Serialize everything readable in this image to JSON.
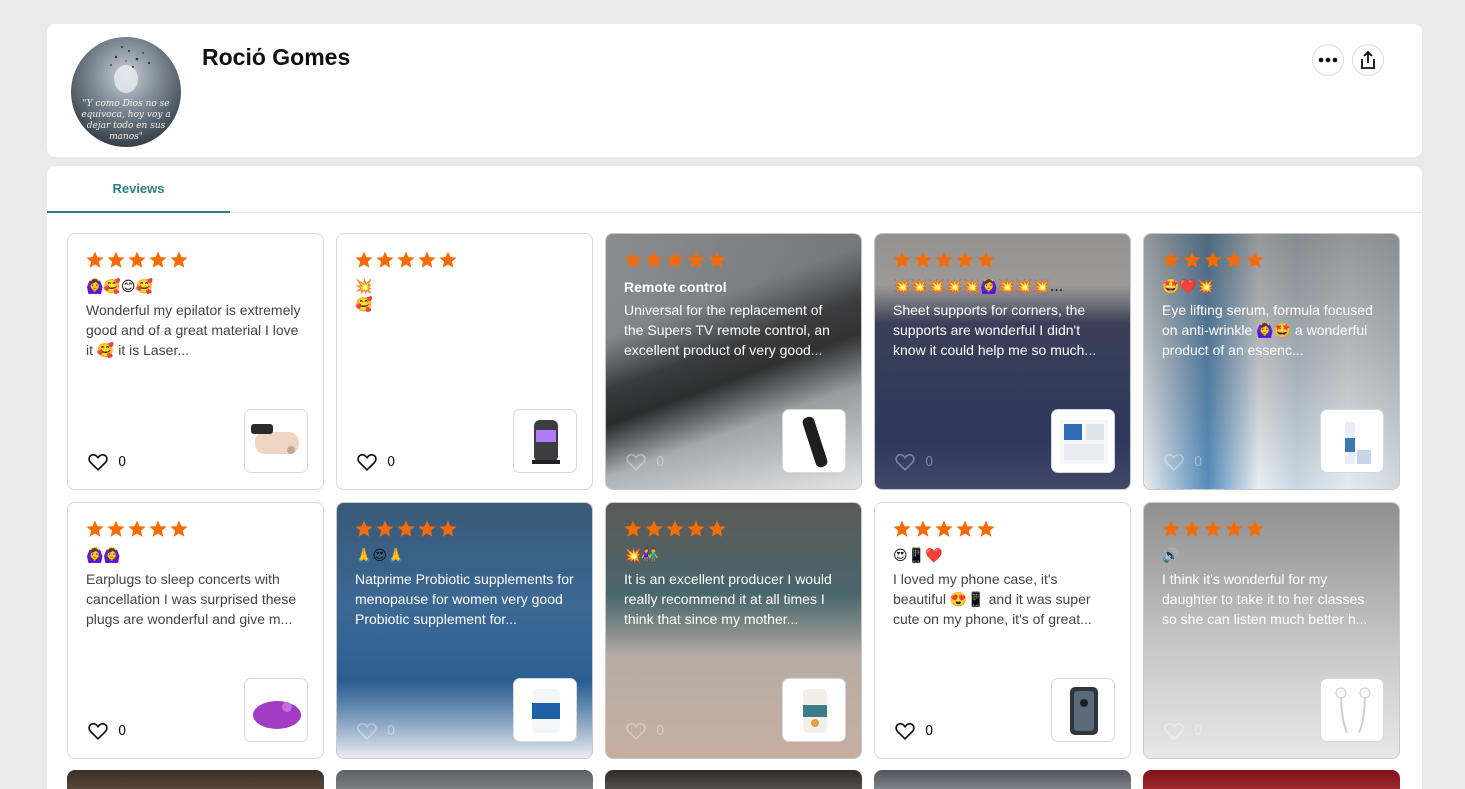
{
  "profile": {
    "name": "Rociό Gomes",
    "avatar_quote": "\"Y como Dios no se equivoca, hoy voy a dejar todo en sus manos\""
  },
  "actions": {
    "more_icon": "more-dots-icon",
    "share_icon": "share-icon"
  },
  "tabs": [
    {
      "label": "Reviews",
      "active": true
    }
  ],
  "colors": {
    "star": "#f76b00",
    "tab_accent": "#2a7f86"
  },
  "reviews": [
    {
      "rating": 5,
      "title": "",
      "emojis": "🙆‍♀️🥰😊🥰",
      "text": "Wonderful my epilator is extremely good and of a great material I love it 🥰 it is Laser...",
      "likes": "0",
      "style": "plain",
      "product": "epilator"
    },
    {
      "rating": 5,
      "title": "",
      "emojis": "💥\n🥰",
      "text": "",
      "likes": "0",
      "style": "plain",
      "product": "lamp"
    },
    {
      "rating": 5,
      "title": "Remote control",
      "emojis": "",
      "text": "Universal for the replacement of the Supers TV remote control, an excellent product of very good...",
      "likes": "0",
      "style": "photo",
      "product": "remote"
    },
    {
      "rating": 5,
      "title": "",
      "emojis": "💥💥💥💥💥🙆‍♀️💥💥💥...",
      "text": "Sheet supports for corners, the supports are wonderful I didn't know it could help me so much...",
      "likes": "0",
      "style": "photo",
      "product": "sheet-holder"
    },
    {
      "rating": 5,
      "title": "",
      "emojis": "🤩❤️💥",
      "text": "Eye lifting serum, formula focused on anti-wrinkle 🙆‍♀️🤩 a wonderful product of an essenc...",
      "likes": "0",
      "style": "photo",
      "product": "serum"
    },
    {
      "rating": 5,
      "title": "",
      "emojis": "🙆‍♀️🙆‍♀️",
      "text": "Earplugs to sleep concerts with cancellation I was surprised these plugs are wonderful and give m...",
      "likes": "0",
      "style": "plain",
      "product": "earplugs"
    },
    {
      "rating": 5,
      "title": "",
      "emojis": "🙏😍🙏",
      "text": "Natprime Probiotic supplements for menopause for women very good Probiotic supplement for...",
      "likes": "0",
      "style": "photo",
      "product": "probiotic"
    },
    {
      "rating": 5,
      "title": "",
      "emojis": "💥👫",
      "text": "It is an excellent producer I would really recommend it at all times I think that since my mother...",
      "likes": "0",
      "style": "photo",
      "product": "supplement"
    },
    {
      "rating": 5,
      "title": "",
      "emojis": "😍📱❤️",
      "text": "I loved my phone case, it's beautiful 😍📱 and it was super cute on my phone, it's of great...",
      "likes": "0",
      "style": "plain",
      "product": "phone-case"
    },
    {
      "rating": 5,
      "title": "",
      "emojis": "🔊",
      "text": "I think it's wonderful for my daughter to take it to her classes so she can listen much better h...",
      "likes": "0",
      "style": "photo",
      "product": "earphones"
    }
  ]
}
